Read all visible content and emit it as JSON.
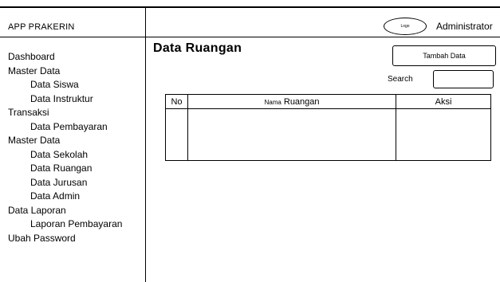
{
  "header": {
    "app_title": "APP PRAKERIN",
    "logo_label": "Logo",
    "user_name": "Administrator"
  },
  "sidebar": {
    "items": [
      {
        "label": "Dashboard",
        "level": 0
      },
      {
        "label": "Master Data",
        "level": 0
      },
      {
        "label": "Data Siswa",
        "level": 1
      },
      {
        "label": "Data Instruktur",
        "level": 1
      },
      {
        "label": "Transaksi",
        "level": 0
      },
      {
        "label": "Data Pembayaran",
        "level": 1
      },
      {
        "label": "Master Data",
        "level": 0
      },
      {
        "label": "Data Sekolah",
        "level": 1
      },
      {
        "label": "Data Ruangan",
        "level": 1
      },
      {
        "label": "Data Jurusan",
        "level": 1
      },
      {
        "label": "Data Admin",
        "level": 1
      },
      {
        "label": "Data Laporan",
        "level": 0
      },
      {
        "label": "Laporan Pembayaran",
        "level": 1
      },
      {
        "label": "Ubah Password",
        "level": 0
      }
    ]
  },
  "main": {
    "title": "Data Ruangan",
    "add_button": "Tambah Data",
    "search_label": "Search",
    "search_value": "",
    "table": {
      "col_no": "No",
      "col_nama_prefix": "Nama",
      "col_nama": "Ruangan",
      "col_aksi": "Aksi"
    }
  }
}
